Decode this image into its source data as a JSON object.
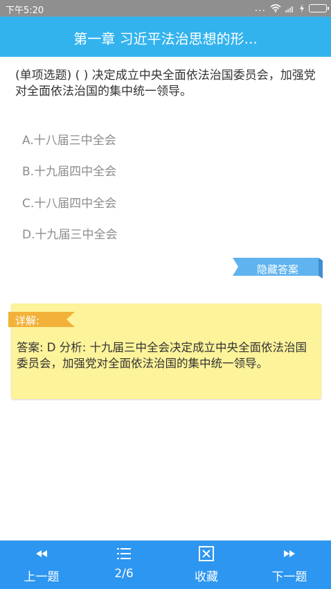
{
  "status_bar": {
    "time": "下午5:20",
    "dots": "..."
  },
  "header": {
    "title": "第一章 习近平法治思想的形..."
  },
  "question": {
    "text": "(单项选题) ( ) 决定成立中央全面依法治国委员会，加强党对全面依法治国的集中统一领导。"
  },
  "options": [
    {
      "label": "A.十八届三中全会"
    },
    {
      "label": "B.十九届四中全会"
    },
    {
      "label": "C.十八届四中全会"
    },
    {
      "label": "D.十九届三中全会"
    }
  ],
  "hide_answer_label": "隐藏答案",
  "explanation": {
    "tag": "详解:",
    "text": "答案: D 分析: 十九届三中全会决定成立中央全面依法治国委员会，加强党对全面依法治国的集中统一领导。"
  },
  "bottom_nav": {
    "prev": "上一题",
    "progress": "2/6",
    "favorite": "收藏",
    "next": "下一题"
  },
  "colors": {
    "header_bg": "#33b3ee",
    "nav_bg": "#2d96f0",
    "explain_bg": "#fcf39a",
    "tag_bg": "#f2b23a",
    "hide_btn_bg": "#5fb3ee"
  }
}
